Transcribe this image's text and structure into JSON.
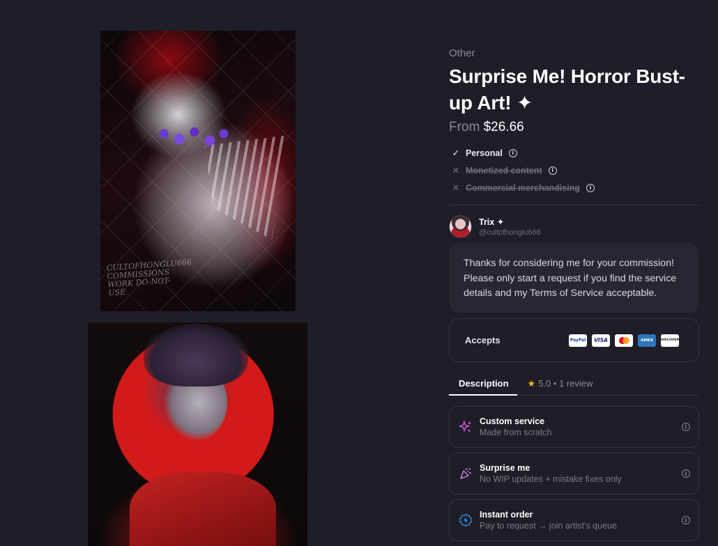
{
  "gallery": {
    "images": [
      {
        "signature": "CULTOFHONGLU666 COMMISSIONS WORK DO-NOT-USE"
      },
      {
        "signature": ""
      }
    ]
  },
  "product": {
    "category": "Other",
    "title": "Surprise Me! Horror Bust-up Art! ✦",
    "price_prefix": "From",
    "price": "$26.66"
  },
  "licenses": [
    {
      "label": "Personal",
      "allowed": true,
      "mark": "✓"
    },
    {
      "label": "Monetized content",
      "allowed": false,
      "mark": "✕"
    },
    {
      "label": "Commercial merchandising",
      "allowed": false,
      "mark": "✕"
    }
  ],
  "artist": {
    "name": "Trix ✦",
    "handle": "@cultofhonglu666",
    "message": "Thanks for considering me for your commission! Please only start a request if you find the service details and my Terms of Service acceptable."
  },
  "payments": {
    "label": "Accepts",
    "methods": [
      {
        "name": "paypal-icon",
        "text": "PayPal"
      },
      {
        "name": "visa-icon",
        "text": "VISA"
      },
      {
        "name": "mastercard-icon",
        "text": ""
      },
      {
        "name": "amex-icon",
        "text": "AMEX"
      },
      {
        "name": "discover-icon",
        "text": "DISCOVER"
      }
    ]
  },
  "tabs": {
    "description": "Description",
    "reviews_star": "★",
    "reviews": "5.0 • 1 review"
  },
  "features": [
    {
      "icon": "sparkles-icon",
      "glyph": "✦",
      "color": "#d05ad8",
      "title": "Custom service",
      "subtitle": "Made from scratch"
    },
    {
      "icon": "party-popper-icon",
      "glyph": "🎉",
      "color": "#d58ae0",
      "title": "Surprise me",
      "subtitle": "No WIP updates + mistake fixes only"
    },
    {
      "icon": "lightning-badge-icon",
      "glyph": "⚡",
      "color": "#3a8fe0",
      "title": "Instant order",
      "subtitle": "Pay to request → join artist's queue"
    }
  ],
  "colors": {
    "background": "#1e1e29",
    "card": "#272733",
    "border": "#353542",
    "muted_text": "#8a8a96",
    "star": "#f5b21b"
  }
}
